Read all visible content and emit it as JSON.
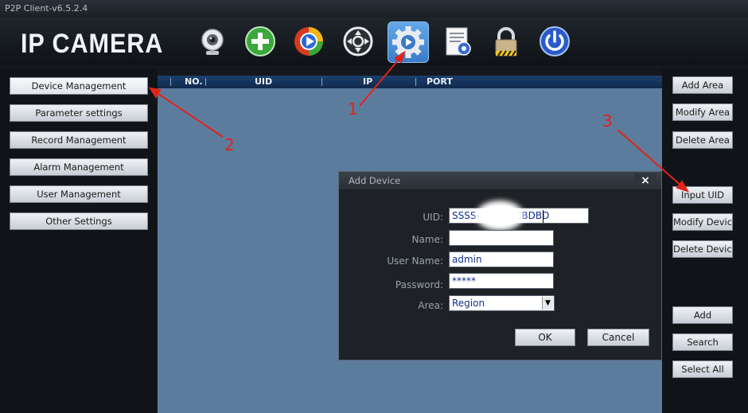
{
  "window": {
    "title": "P2P Client-v6.5.2.4"
  },
  "brand": {
    "logo_text": "IP CAMERA"
  },
  "toolbar": {
    "icons": [
      "webcam-icon",
      "add-icon",
      "playback-icon",
      "ptz-control-icon",
      "settings-gear-icon",
      "log-document-icon",
      "lock-icon",
      "power-icon"
    ],
    "active": "settings-gear-icon"
  },
  "sidebar": {
    "items": [
      {
        "label": "Device Management",
        "selected": true
      },
      {
        "label": "Parameter settings"
      },
      {
        "label": "Record Management"
      },
      {
        "label": "Alarm Management"
      },
      {
        "label": "User Management"
      },
      {
        "label": "Other Settings"
      }
    ]
  },
  "table": {
    "columns": [
      "NO.",
      "UID",
      "IP",
      "PORT"
    ]
  },
  "right_panel": {
    "buttons": [
      "Add Area",
      "Modify Area",
      "Delete Area",
      "Input UID",
      "Modify Device",
      "Delete Device",
      "Add",
      "Search",
      "Select All"
    ]
  },
  "dialog": {
    "title": "Add Device",
    "close_label": "×",
    "fields": {
      "uid": {
        "label": "UID:",
        "value_start": "SSSS-S",
        "value_end": "CBDBD"
      },
      "name": {
        "label": "Name:",
        "value": ""
      },
      "user_name": {
        "label": "User Name:",
        "value": "admin"
      },
      "password": {
        "label": "Password:",
        "value": "*****"
      },
      "area": {
        "label": "Area:",
        "value": "Region",
        "dropdown_arrow": "▼"
      }
    },
    "ok_label": "OK",
    "cancel_label": "Cancel"
  },
  "annotations": {
    "step1": "1",
    "step2": "2",
    "step3": "3"
  },
  "colors": {
    "annotation": "#e02418",
    "table_area": "#5c7c9e",
    "accent_blue": "#3a7cc8"
  }
}
